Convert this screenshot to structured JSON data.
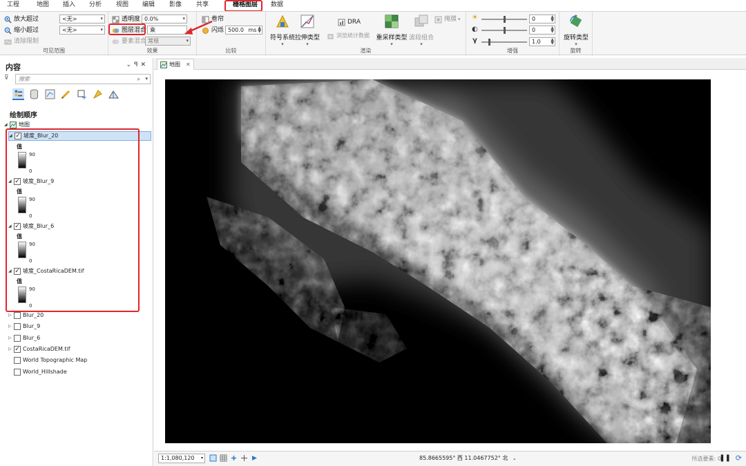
{
  "ribbon_tabs": [
    "工程",
    "地图",
    "插入",
    "分析",
    "视图",
    "编辑",
    "影像",
    "共享",
    "栅格图层",
    "数据"
  ],
  "active_tab": "栅格图层",
  "visible_range": {
    "zoom_in_label": "放大超过",
    "zoom_in_value": "<无>",
    "zoom_out_label": "缩小超过",
    "zoom_out_value": "<无>",
    "clear_label": "清除限制",
    "group_label": "可见范围"
  },
  "effects": {
    "transparency_label": "透明度",
    "transparency_value": "0.0%",
    "blend_label": "图层混合",
    "blend_value": "乘",
    "feature_blend_label": "要素混合",
    "feature_blend_value": "常规",
    "group_label": "效果"
  },
  "compare": {
    "swipe_label": "卷帘",
    "flicker_label": "闪烁",
    "flicker_value": "500.0",
    "flicker_unit": "ms",
    "group_label": "比较"
  },
  "rendering": {
    "symbology_label": "符号系统",
    "stretch_label": "拉伸类型",
    "dra_label": "DRA",
    "stats_label": "浏览统计数据",
    "resample_label": "重采样类型",
    "band_combo_label": "波段组合",
    "mask_label": "掩膜",
    "group_label": "渲染"
  },
  "enhance": {
    "brightness_value": "0",
    "contrast_value": "0",
    "gamma_value": "1.0",
    "group_label": "增强"
  },
  "rotation": {
    "rotate_label": "旋转类型",
    "group_label": "旋转"
  },
  "contents": {
    "title": "内容",
    "search_placeholder": "搜索",
    "section_label": "绘制顺序",
    "map_label": "地图",
    "legend_header": "值",
    "legend_max": "90",
    "legend_min": "0",
    "layers_top": [
      "坡度_Blur_20",
      "坡度_Blur_9",
      "坡度_Blur_6",
      "坡度_CostaRicaDEM.tif"
    ],
    "layers_bottom": [
      {
        "name": "Blur_20",
        "checked": false
      },
      {
        "name": "Blur_9",
        "checked": false
      },
      {
        "name": "Blur_6",
        "checked": false
      },
      {
        "name": "CostaRicaDEM.tif",
        "checked": true
      },
      {
        "name": "World Topographic Map",
        "checked": false
      },
      {
        "name": "World_Hillshade",
        "checked": false
      }
    ]
  },
  "map_tab": "地图",
  "status": {
    "scale": "1:1,080,120",
    "coordinates": "85.8665595° 西  11.0467752° 北",
    "selected_features": "所选要素: 0"
  },
  "colors": {
    "accent": "#2f79c6",
    "highlight_red": "#e0252b",
    "selection": "#cfe2f6"
  }
}
